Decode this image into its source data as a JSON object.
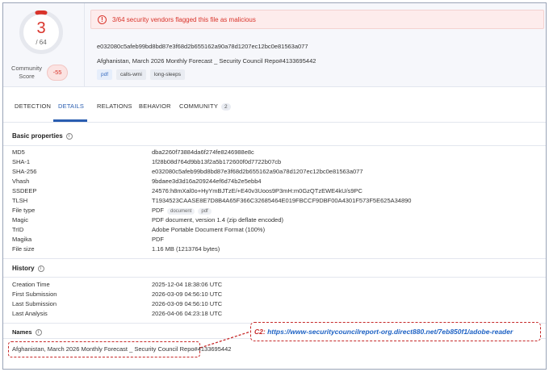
{
  "score": {
    "detected": "3",
    "total": "/ 64",
    "community_label": "Community Score",
    "community_value": "-55"
  },
  "alert": {
    "icon": "!",
    "text": "3/64 security vendors flagged this file as malicious"
  },
  "file": {
    "hash": "e032080c5afeb99bd8bd87e3f68d2b655162a90a78d1207ec12bc0e81563a077",
    "name": "Afghanistan, March 2026 Monthly Forecast _ Security Council Repo#4133695442",
    "tags": [
      "pdf",
      "calls-wmi",
      "long-sleeps"
    ]
  },
  "tabs": [
    {
      "label": "DETECTION"
    },
    {
      "label": "DETAILS"
    },
    {
      "label": "RELATIONS"
    },
    {
      "label": "BEHAVIOR"
    },
    {
      "label": "COMMUNITY",
      "count": "2"
    }
  ],
  "basic": {
    "title": "Basic properties",
    "rows": [
      {
        "k": "MD5",
        "v": "dba2260f73884da6f274fe8246988e8c"
      },
      {
        "k": "SHA-1",
        "v": "1f28b08d764d9bb13f2a5b172600f0d7722b07cb"
      },
      {
        "k": "SHA-256",
        "v": "e032080c5afeb99bd8bd87e3f68d2b655162a90a78d1207ec12bc0e81563a077"
      },
      {
        "k": "Vhash",
        "v": "9bdaee3d3d16a209244ef6d74b2e5ebb4"
      },
      {
        "k": "SSDEEP",
        "v": "24576:h8mXal0o+HyYmBJTzE/+E40v3Uoos9P3mH:m0GzQTzEWE4kU/s9PC"
      },
      {
        "k": "TLSH",
        "v": "T1934523CAASE8E7D8B4A65F366C32685464E019FBCCF9DBF00A4301F573F5E625A34890"
      },
      {
        "k": "File type",
        "v": "PDF",
        "tags": [
          "document",
          "pdf"
        ]
      },
      {
        "k": "Magic",
        "v": "PDF document, version 1.4 (zip deflate encoded)"
      },
      {
        "k": "TrID",
        "v": "Adobe Portable Document Format (100%)"
      },
      {
        "k": "Magika",
        "v": "PDF"
      },
      {
        "k": "File size",
        "v": "1.16 MB (1213764 bytes)"
      }
    ]
  },
  "history": {
    "title": "History",
    "rows": [
      {
        "k": "Creation Time",
        "v": "2025-12-04 18:38:06 UTC"
      },
      {
        "k": "First Submission",
        "v": "2026-03-09 04:56:10 UTC"
      },
      {
        "k": "Last Submission",
        "v": "2026-03-09 04:56:10 UTC"
      },
      {
        "k": "Last Analysis",
        "v": "2026-04-06 04:23:18 UTC"
      }
    ]
  },
  "names": {
    "title": "Names",
    "value": "Afghanistan, March 2026 Monthly Forecast _ Security Council Repo#4133695442"
  },
  "annotation": {
    "label": "C2:",
    "url": "https://www-securitycouncilreport-org.direct880.net/7eb850f1/adobe-reader",
    "color": "#c62828"
  },
  "colors": {
    "accent": "#2a5db0",
    "malicious": "#d9342b",
    "link": "#1e62c4"
  }
}
